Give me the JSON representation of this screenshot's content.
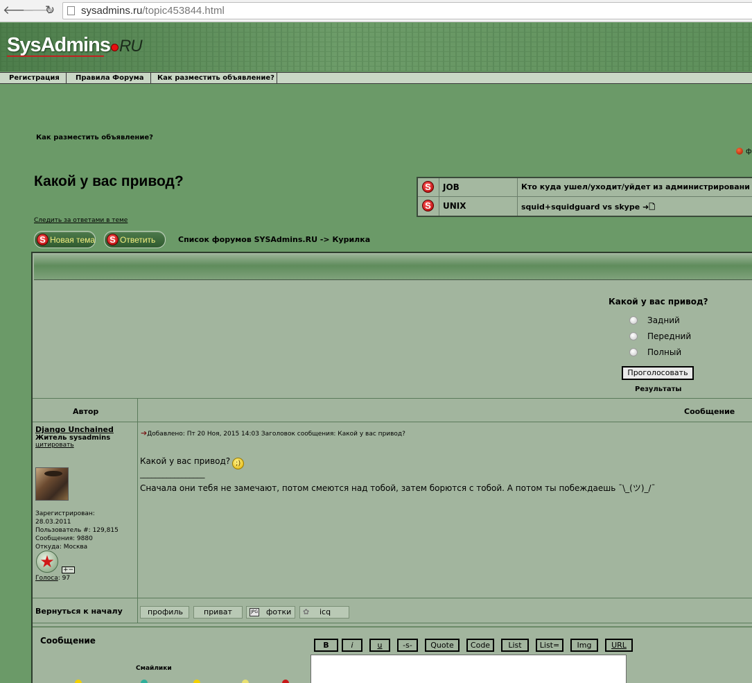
{
  "browser": {
    "url_host": "sysadmins.ru",
    "url_path": "/topic453844.html"
  },
  "logo": {
    "main": "SysAdmins",
    "suffix": "RU"
  },
  "nav": {
    "items": [
      {
        "label": "Регистрация"
      },
      {
        "label": "Правила Форума"
      },
      {
        "label": "Как разместить объявление?"
      }
    ]
  },
  "ad_link": "Как разместить объявление?",
  "right_bullet_text": "ф",
  "topic": {
    "title": "Какой у вас привод?"
  },
  "related": [
    {
      "category": "JOB",
      "title": "Кто куда ушел/уходит/уйдет из администрировани"
    },
    {
      "category": "UNIX",
      "title": "squid+squidguard vs skype ➜🗋"
    }
  ],
  "watch_link": "Следить за ответами в теме",
  "buttons": {
    "new_topic": "Новая тема",
    "reply": "Ответить"
  },
  "breadcrumb": "Список форумов SYSAdmins.RU -> Курилка",
  "poll": {
    "question": "Какой у вас привод?",
    "options": [
      "Задний",
      "Передний",
      "Полный"
    ],
    "vote_label": "Проголосовать",
    "results_label": "Результаты"
  },
  "table": {
    "author_header": "Автор",
    "message_header": "Сообщение"
  },
  "post": {
    "author": "Django Unchained",
    "rank": "Житель sysadmins",
    "quote_label": "цитировать",
    "stats": [
      "Зарегистрирован:",
      "28.03.2011",
      "Пользователь #: 129,815",
      "Сообщения: 9880",
      "Откуда: Москва"
    ],
    "votes_label": "Голоса",
    "votes_value": ": 97",
    "plus_minus": "+−",
    "meta": "Добавлено: Пт 20 Ноя, 2015 14:03     Заголовок сообщения: Какой у вас привод?",
    "body": "Какой у вас привод?",
    "sig_line": "_________________",
    "signature": "Сначала они тебя не замечают, потом смеются над тобой, затем борются с тобой. А потом ты побеждаешь ¯\\_(ツ)_/¯"
  },
  "back_to_top": "Вернуться к началу",
  "profile_buttons": [
    {
      "label": "профиль"
    },
    {
      "label": "приват"
    },
    {
      "label": "фотки",
      "icon": "JPG"
    },
    {
      "label": "icq"
    }
  ],
  "reply": {
    "label": "Сообщение",
    "smilies_label": "Смайлики",
    "format_buttons": [
      "B",
      "i",
      "u",
      "-s-",
      "Quote",
      "Code",
      "List",
      "List=",
      "Img",
      "URL"
    ]
  }
}
